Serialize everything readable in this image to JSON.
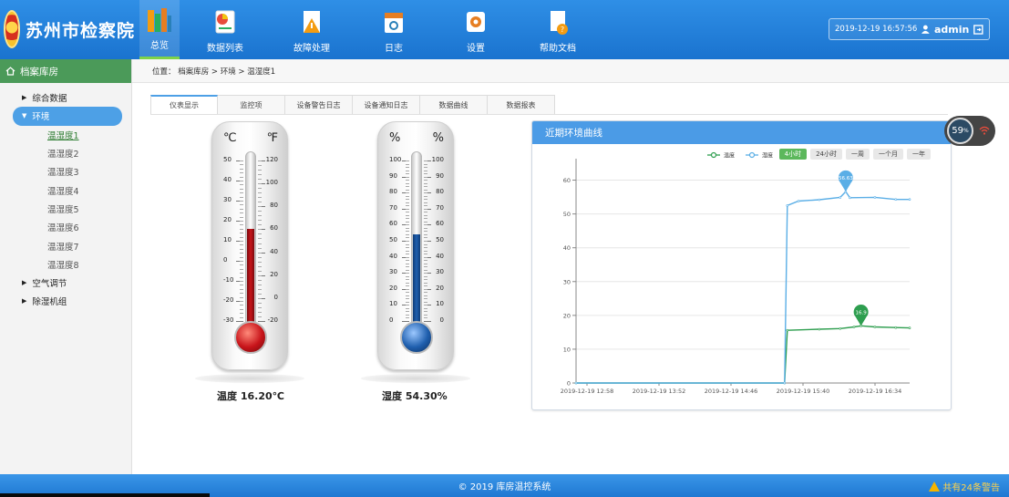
{
  "header": {
    "org_name": "苏州市检察院",
    "nav": [
      {
        "label": "总览",
        "icon": "books-icon",
        "active": true
      },
      {
        "label": "数据列表",
        "icon": "chart-list-icon"
      },
      {
        "label": "故障处理",
        "icon": "warning-doc-icon"
      },
      {
        "label": "日志",
        "icon": "calendar-icon"
      },
      {
        "label": "设置",
        "icon": "gear-icon"
      },
      {
        "label": "帮助文档",
        "icon": "help-doc-icon"
      }
    ],
    "datetime": "2019-12-19 16:57:56",
    "username": "admin"
  },
  "sidebar": {
    "title": "档案库房",
    "groups": [
      {
        "label": "综合数据",
        "open": false
      },
      {
        "label": "环境",
        "open": true
      }
    ],
    "leaves": [
      "温湿度1",
      "温湿度2",
      "温湿度3",
      "温湿度4",
      "温湿度5",
      "温湿度6",
      "温湿度7",
      "温湿度8"
    ],
    "groups_after": [
      "空气调节",
      "除湿机组"
    ]
  },
  "breadcrumb": "位置：  档案库房 > 环境 > 温湿度1",
  "tabs": [
    "仪表显示",
    "监控项",
    "设备警告日志",
    "设备通知日志",
    "数据曲线",
    "数据报表"
  ],
  "thermometer": {
    "unit_left": "℃",
    "unit_right": "℉",
    "celsius_ticks": [
      "50",
      "40",
      "30",
      "20",
      "10",
      "0",
      "-10",
      "-20",
      "-30"
    ],
    "fahrenheit_ticks": [
      "120",
      "100",
      "80",
      "60",
      "40",
      "20",
      "0",
      "-20"
    ],
    "value": 16.2,
    "reading_label": "温度",
    "reading_value": "16.20℃",
    "fill_color": "#c8141a"
  },
  "hygrometer": {
    "unit_left": "%",
    "unit_right": "%",
    "ticks": [
      "100",
      "90",
      "80",
      "70",
      "60",
      "50",
      "40",
      "30",
      "20",
      "10",
      "0"
    ],
    "value": 54.3,
    "reading_label": "湿度",
    "reading_value": "54.30%",
    "fill_color": "#1f5fae"
  },
  "chart_panel": {
    "title": "近期环境曲线",
    "ranges": [
      "4小时",
      "24小时",
      "一周",
      "一个月",
      "一年"
    ],
    "active_range": "4小时"
  },
  "chart_data": {
    "type": "line",
    "legend": [
      "温度",
      "湿度"
    ],
    "legend_position": "top-center",
    "x_ticks": [
      "2019-12-19 12:58",
      "2019-12-19 13:52",
      "2019-12-19 14:46",
      "2019-12-19 15:40",
      "2019-12-19 16:34"
    ],
    "xlim_minutes": [
      0,
      240
    ],
    "ylim": [
      0,
      65
    ],
    "y_ticks": [
      0,
      10,
      20,
      30,
      40,
      50,
      60
    ],
    "grid": true,
    "series": [
      {
        "name": "温度",
        "color": "#2e9e4f",
        "points": [
          [
            0,
            0
          ],
          [
            150,
            0
          ],
          [
            152,
            15.6
          ],
          [
            175,
            15.9
          ],
          [
            190,
            16.1
          ],
          [
            200,
            16.6
          ],
          [
            205,
            16.9
          ],
          [
            215,
            16.6
          ],
          [
            230,
            16.4
          ],
          [
            240,
            16.3
          ]
        ]
      },
      {
        "name": "湿度",
        "color": "#5aaee6",
        "points": [
          [
            0,
            0
          ],
          [
            150,
            0
          ],
          [
            152,
            52.5
          ],
          [
            160,
            53.8
          ],
          [
            175,
            54.2
          ],
          [
            190,
            54.9
          ],
          [
            194,
            56.6
          ],
          [
            197,
            54.8
          ],
          [
            215,
            54.9
          ],
          [
            230,
            54.3
          ],
          [
            240,
            54.3
          ]
        ]
      }
    ],
    "markers": [
      {
        "series": "湿度",
        "label": "56.63",
        "x": 194,
        "y": 56.6
      },
      {
        "series": "温度",
        "label": "16.9",
        "x": 205,
        "y": 16.9
      }
    ]
  },
  "float_widget": {
    "value": "59",
    "unit": "%"
  },
  "footer": {
    "copyright": "© 2019  库房温控系统",
    "warning": "共有24条警告"
  }
}
